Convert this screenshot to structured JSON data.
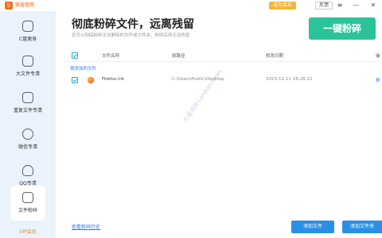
{
  "titlebar": {
    "app_title": "猫盾管理",
    "logo_glyph": "S",
    "vip_label": "成为会员",
    "feedback_label": "反馈",
    "minimize_glyph": "—",
    "close_glyph": "✕",
    "menu_glyph": "≡"
  },
  "sidebar": {
    "items": [
      {
        "label": "C盘瘦身",
        "icon": "c-drive-icon"
      },
      {
        "label": "大文件专清",
        "icon": "large-file-icon"
      },
      {
        "label": "重复文件专清",
        "icon": "duplicate-file-icon"
      },
      {
        "label": "微信专清",
        "icon": "wechat-icon"
      },
      {
        "label": "QQ专清",
        "icon": "qq-icon"
      },
      {
        "label": "文件粉碎",
        "icon": "shredder-icon",
        "active": true
      }
    ],
    "vip_strip": "VIP会员"
  },
  "header": {
    "title": "彻底粉碎文件，远离残留",
    "subtitle": "您可以彻底粉碎无法删除的文件或文件夹，粉碎后将无法恢复",
    "shred_button": "一键粉碎"
  },
  "table": {
    "columns": [
      "文件名称",
      "原路径",
      "修改日期",
      "操"
    ],
    "group_label": "我添加的文件",
    "rows": [
      {
        "name": "Firefox.lnk",
        "path": "C:\\Users\\Public\\Desktop",
        "date": "2023-12-11 16:28:12",
        "op": "移"
      }
    ]
  },
  "watermark": "©蓝点网 Landian.News",
  "footer": {
    "history_link": "查看粉碎历史",
    "add_file": "添加文件",
    "add_folder": "添加文件夹"
  },
  "colors": {
    "accent_green": "#2ac39a",
    "accent_blue": "#2a8fe6",
    "brand_orange": "#ff6a1a",
    "sidebar_bg": "#eaf2fb"
  }
}
